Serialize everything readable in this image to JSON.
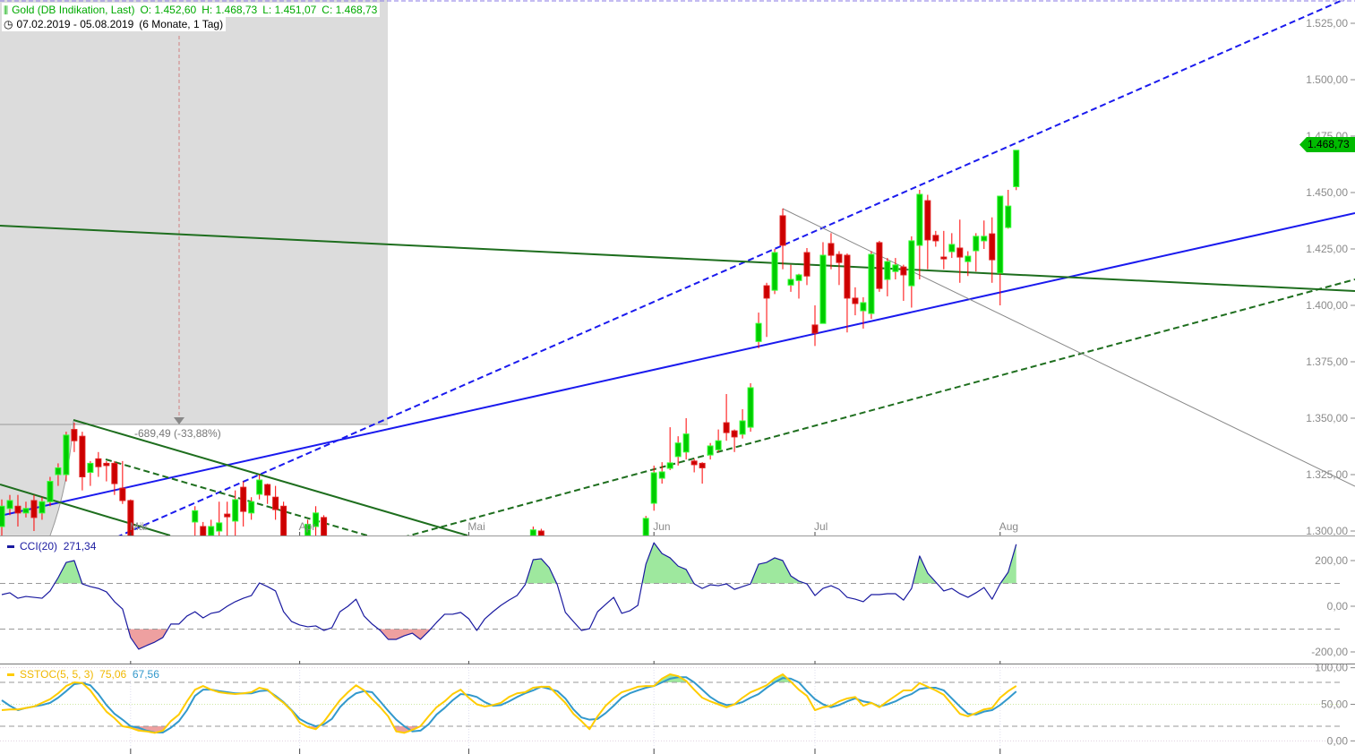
{
  "header": {
    "instrument": "Gold (DB Indikation, Last)",
    "open": "O: 1.452,60",
    "high": "H: 1.468,73",
    "low": "L: 1.451,07",
    "close": "C: 1.468,73",
    "range": "07.02.2019 - 05.08.2019",
    "period": "(6 Monate, 1 Tag)",
    "icons": [
      "chart-settings-icon",
      "clock-icon"
    ]
  },
  "measurement_label": "-689,49 (-33,88%)",
  "last_price_label": "1.468,73",
  "colors": {
    "up": "#00cc00",
    "down": "#cc0000",
    "wick": "#ff0000",
    "trend_blue": "#1a1aee",
    "trend_green": "#1e6e1e",
    "cci": "#1a1aa0",
    "stoc_k": "#ffcc00",
    "stoc_d": "#3399cc",
    "last_price_bg": "#00bb00"
  },
  "price_axis": [
    {
      "value": 1525,
      "label": "1.525,00"
    },
    {
      "value": 1500,
      "label": "1.500,00"
    },
    {
      "value": 1475,
      "label": "1.475,00"
    },
    {
      "value": 1450,
      "label": "1.450,00"
    },
    {
      "value": 1425,
      "label": "1.425,00"
    },
    {
      "value": 1400,
      "label": "1.400,00"
    },
    {
      "value": 1375,
      "label": "1.375,00"
    },
    {
      "value": 1350,
      "label": "1.350,00"
    },
    {
      "value": 1325,
      "label": "1.325,00"
    },
    {
      "value": 1300,
      "label": "1.300,00"
    }
  ],
  "months": [
    {
      "label": "Mär",
      "n": 16
    },
    {
      "label": "Apr",
      "n": 37
    },
    {
      "label": "Mai",
      "n": 58
    },
    {
      "label": "Jun",
      "n": 81
    },
    {
      "label": "Jul",
      "n": 101
    },
    {
      "label": "Aug",
      "n": 124
    }
  ],
  "cci": {
    "label": "CCI(20)",
    "value": "271,34",
    "axis": [
      {
        "value": 200,
        "label": "200,00"
      },
      {
        "value": 0,
        "label": "0,00"
      },
      {
        "value": -200,
        "label": "-200,00"
      }
    ],
    "levels": [
      100,
      -100
    ],
    "values": [
      51,
      59,
      35,
      43,
      39,
      35,
      67,
      125,
      192,
      200,
      98,
      86,
      78,
      63,
      20,
      -12,
      -137,
      -188,
      -172,
      -157,
      -137,
      -78,
      -78,
      -43,
      -24,
      -51,
      -31,
      -24,
      0,
      20,
      35,
      47,
      102,
      86,
      67,
      -24,
      -67,
      -82,
      -90,
      -86,
      -106,
      -94,
      -24,
      0,
      31,
      -43,
      -78,
      -106,
      -145,
      -145,
      -129,
      -118,
      -145,
      -110,
      -71,
      -35,
      -35,
      -27,
      -55,
      -106,
      -55,
      -24,
      4,
      27,
      47,
      94,
      204,
      208,
      169,
      94,
      -27,
      -67,
      -106,
      -98,
      -24,
      8,
      39,
      -31,
      -20,
      4,
      184,
      278,
      231,
      212,
      176,
      161,
      98,
      78,
      94,
      90,
      98,
      74,
      86,
      98,
      184,
      192,
      212,
      200,
      133,
      110,
      98,
      47,
      78,
      90,
      74,
      39,
      31,
      20,
      51,
      51,
      55,
      55,
      27,
      78,
      220,
      145,
      106,
      67,
      78,
      55,
      39,
      59,
      82,
      31,
      98,
      149,
      271.34
    ]
  },
  "sstoc": {
    "label": "SSTOC(5, 5, 3)",
    "k_value": "75,06",
    "d_value": "67,56",
    "axis": [
      {
        "value": 100,
        "label": "100,00"
      },
      {
        "value": 50,
        "label": "50,00"
      },
      {
        "value": 0,
        "label": "0,00"
      }
    ],
    "levels": [
      80,
      20
    ],
    "k": [
      42,
      43,
      43,
      45,
      47,
      52,
      57,
      65,
      75,
      80,
      79,
      69,
      54,
      40,
      31,
      20,
      18,
      14,
      13,
      11,
      14,
      27,
      36,
      54,
      70,
      75,
      70,
      66.5,
      65,
      64,
      65,
      66.5,
      72.6,
      70,
      60,
      52,
      41,
      25,
      19,
      16,
      26,
      41,
      55.5,
      66.5,
      76,
      69,
      57,
      46,
      33.5,
      13,
      11,
      15,
      20,
      33.5,
      46,
      54,
      64,
      70,
      59,
      50,
      47,
      49,
      52,
      60,
      65,
      66.5,
      72.6,
      74,
      74,
      63,
      52,
      37,
      27,
      16,
      33.5,
      48,
      58,
      66.5,
      70,
      74,
      75,
      75,
      85,
      91,
      88.5,
      82,
      70,
      59,
      54,
      50,
      46,
      50,
      59,
      66.5,
      71,
      76,
      85,
      91,
      81,
      70,
      61.6,
      42,
      46,
      48,
      54,
      58,
      60,
      48,
      52,
      46,
      54,
      61.6,
      69,
      69,
      79,
      74,
      69,
      63,
      50,
      37,
      33.5,
      38,
      43,
      45,
      59,
      68,
      75.06
    ],
    "d": [
      55.5,
      48,
      42,
      45,
      47,
      49,
      52,
      59,
      68,
      77.5,
      79,
      76,
      64,
      49,
      37,
      29,
      20,
      18,
      14,
      11.5,
      11.5,
      18,
      27,
      42,
      61.6,
      70,
      70,
      68,
      66.5,
      65,
      65,
      65,
      68,
      69,
      61.6,
      53,
      42,
      30,
      24,
      20,
      22.5,
      30,
      46,
      57,
      65,
      68,
      66.5,
      54,
      41,
      29,
      20,
      13,
      14,
      22.5,
      36,
      45,
      55.5,
      64,
      63,
      60,
      53,
      48,
      49,
      54,
      60,
      65,
      69,
      74,
      71,
      68,
      58,
      43,
      32,
      29,
      30,
      38,
      48,
      59,
      65,
      69,
      72.6,
      75,
      80,
      85,
      87,
      87,
      80,
      70,
      60,
      53,
      49,
      50,
      53,
      59,
      64,
      72.6,
      80,
      86,
      85,
      80,
      68,
      57,
      50,
      46,
      49,
      54,
      58,
      54,
      52,
      47,
      50,
      54,
      60,
      64,
      71,
      72.6,
      72.6,
      69,
      58,
      47,
      37,
      36,
      40,
      42,
      49,
      58,
      67.56
    ]
  },
  "chart_data": {
    "type": "candlestick",
    "candles": [
      {
        "n": 0,
        "o": 1302,
        "h": 1314,
        "l": 1298,
        "c": 1311
      },
      {
        "n": 1,
        "o": 1310,
        "h": 1316,
        "l": 1307,
        "c": 1313.5
      },
      {
        "n": 2,
        "o": 1311,
        "h": 1316,
        "l": 1302,
        "c": 1308
      },
      {
        "n": 3,
        "o": 1308,
        "h": 1313,
        "l": 1306,
        "c": 1310
      },
      {
        "n": 4,
        "o": 1313.5,
        "h": 1316,
        "l": 1300,
        "c": 1306
      },
      {
        "n": 5,
        "o": 1308,
        "h": 1315,
        "l": 1305,
        "c": 1313
      },
      {
        "n": 6,
        "o": 1313,
        "h": 1324,
        "l": 1311,
        "c": 1322
      },
      {
        "n": 7,
        "o": 1325,
        "h": 1330,
        "l": 1320,
        "c": 1328
      },
      {
        "n": 8,
        "o": 1325,
        "h": 1344,
        "l": 1322,
        "c": 1342.5
      },
      {
        "n": 9,
        "o": 1345,
        "h": 1348,
        "l": 1335,
        "c": 1340
      },
      {
        "n": 10,
        "o": 1342,
        "h": 1344,
        "l": 1318,
        "c": 1324
      },
      {
        "n": 11,
        "o": 1326,
        "h": 1331,
        "l": 1320,
        "c": 1330
      },
      {
        "n": 12,
        "o": 1332,
        "h": 1335,
        "l": 1324,
        "c": 1328.5
      },
      {
        "n": 13,
        "o": 1330,
        "h": 1331,
        "l": 1322,
        "c": 1329
      },
      {
        "n": 14,
        "o": 1330,
        "h": 1331,
        "l": 1316,
        "c": 1321
      },
      {
        "n": 15,
        "o": 1319,
        "h": 1331,
        "l": 1312,
        "c": 1313.5
      },
      {
        "n": 16,
        "o": 1313.5,
        "h": 1314,
        "l": 1290,
        "c": 1298
      },
      {
        "n": 24,
        "o": 1304,
        "h": 1311,
        "l": 1298,
        "c": 1309
      },
      {
        "n": 25,
        "o": 1302,
        "h": 1304,
        "l": 1294,
        "c": 1297
      },
      {
        "n": 26,
        "o": 1298,
        "h": 1305,
        "l": 1292,
        "c": 1302
      },
      {
        "n": 27,
        "o": 1300,
        "h": 1313,
        "l": 1292,
        "c": 1303.6
      },
      {
        "n": 28,
        "o": 1307.5,
        "h": 1313,
        "l": 1290,
        "c": 1306.3
      },
      {
        "n": 29,
        "o": 1304.4,
        "h": 1318,
        "l": 1295,
        "c": 1313.9
      },
      {
        "n": 30,
        "o": 1319.4,
        "h": 1322,
        "l": 1302,
        "c": 1308.7
      },
      {
        "n": 31,
        "o": 1308,
        "h": 1315,
        "l": 1305,
        "c": 1313
      },
      {
        "n": 32,
        "o": 1316.3,
        "h": 1325,
        "l": 1314,
        "c": 1322.6
      },
      {
        "n": 33,
        "o": 1320.6,
        "h": 1321,
        "l": 1312,
        "c": 1315.9
      },
      {
        "n": 34,
        "o": 1315,
        "h": 1320,
        "l": 1305,
        "c": 1309.5
      },
      {
        "n": 35,
        "o": 1311,
        "h": 1313,
        "l": 1290,
        "c": 1297
      },
      {
        "n": 38,
        "o": 1298,
        "h": 1305,
        "l": 1295,
        "c": 1303
      },
      {
        "n": 39,
        "o": 1302,
        "h": 1311,
        "l": 1298,
        "c": 1308
      },
      {
        "n": 40,
        "o": 1306,
        "h": 1307,
        "l": 1292,
        "c": 1297
      },
      {
        "n": 66,
        "o": 1298,
        "h": 1302,
        "l": 1296,
        "c": 1300.5
      },
      {
        "n": 67,
        "o": 1300,
        "h": 1301,
        "l": 1296,
        "c": 1298
      },
      {
        "n": 80,
        "o": 1298,
        "h": 1306.7,
        "l": 1297,
        "c": 1305.6
      },
      {
        "n": 81,
        "o": 1312.3,
        "h": 1329,
        "l": 1309,
        "c": 1325.8
      },
      {
        "n": 82,
        "o": 1323.4,
        "h": 1330.5,
        "l": 1321,
        "c": 1326.2
      },
      {
        "n": 83,
        "o": 1327.8,
        "h": 1346,
        "l": 1327,
        "c": 1330.2
      },
      {
        "n": 84,
        "o": 1333,
        "h": 1342,
        "l": 1329,
        "c": 1339
      },
      {
        "n": 85,
        "o": 1335,
        "h": 1350,
        "l": 1331.7,
        "c": 1343
      },
      {
        "n": 86,
        "o": 1331,
        "h": 1332,
        "l": 1326,
        "c": 1329.4
      },
      {
        "n": 87,
        "o": 1330,
        "h": 1330.5,
        "l": 1321,
        "c": 1328
      },
      {
        "n": 88,
        "o": 1333.7,
        "h": 1339,
        "l": 1331.7,
        "c": 1337.7
      },
      {
        "n": 89,
        "o": 1336,
        "h": 1345,
        "l": 1335,
        "c": 1340
      },
      {
        "n": 90,
        "o": 1348,
        "h": 1360.7,
        "l": 1340,
        "c": 1343.6
      },
      {
        "n": 91,
        "o": 1344.4,
        "h": 1345,
        "l": 1335,
        "c": 1341.7
      },
      {
        "n": 92,
        "o": 1342.9,
        "h": 1354,
        "l": 1341,
        "c": 1348.8
      },
      {
        "n": 93,
        "o": 1346,
        "h": 1365.5,
        "l": 1344,
        "c": 1363.5
      },
      {
        "n": 94,
        "o": 1384,
        "h": 1396.8,
        "l": 1381,
        "c": 1392
      },
      {
        "n": 95,
        "o": 1408.7,
        "h": 1410,
        "l": 1386,
        "c": 1403.2
      },
      {
        "n": 96,
        "o": 1406.7,
        "h": 1425,
        "l": 1405,
        "c": 1423.4
      },
      {
        "n": 97,
        "o": 1439.7,
        "h": 1442.9,
        "l": 1416,
        "c": 1426.6
      },
      {
        "n": 98,
        "o": 1409,
        "h": 1418,
        "l": 1406,
        "c": 1411.5
      },
      {
        "n": 99,
        "o": 1411,
        "h": 1414,
        "l": 1403,
        "c": 1413.5
      },
      {
        "n": 100,
        "o": 1423.4,
        "h": 1425.4,
        "l": 1409,
        "c": 1413
      },
      {
        "n": 101,
        "o": 1391.3,
        "h": 1400,
        "l": 1382,
        "c": 1387.7
      },
      {
        "n": 102,
        "o": 1392,
        "h": 1428,
        "l": 1392,
        "c": 1422.2
      },
      {
        "n": 103,
        "o": 1427.4,
        "h": 1432,
        "l": 1416,
        "c": 1422.2
      },
      {
        "n": 104,
        "o": 1422.6,
        "h": 1424,
        "l": 1409,
        "c": 1419
      },
      {
        "n": 105,
        "o": 1422.2,
        "h": 1423,
        "l": 1388,
        "c": 1403.2
      },
      {
        "n": 106,
        "o": 1403.2,
        "h": 1408,
        "l": 1395.6,
        "c": 1400.8
      },
      {
        "n": 107,
        "o": 1397.6,
        "h": 1403.6,
        "l": 1389.7,
        "c": 1401.2
      },
      {
        "n": 108,
        "o": 1396.4,
        "h": 1424,
        "l": 1394,
        "c": 1422.6
      },
      {
        "n": 109,
        "o": 1427.8,
        "h": 1428.6,
        "l": 1406,
        "c": 1407.5
      },
      {
        "n": 110,
        "o": 1411.5,
        "h": 1421,
        "l": 1404,
        "c": 1419.4
      },
      {
        "n": 111,
        "o": 1415,
        "h": 1421,
        "l": 1411.5,
        "c": 1417.9
      },
      {
        "n": 112,
        "o": 1417,
        "h": 1418,
        "l": 1402,
        "c": 1413.5
      },
      {
        "n": 113,
        "o": 1408.7,
        "h": 1430.6,
        "l": 1399,
        "c": 1428.6
      },
      {
        "n": 114,
        "o": 1426.6,
        "h": 1451.2,
        "l": 1411.5,
        "c": 1449.2
      },
      {
        "n": 115,
        "o": 1446.4,
        "h": 1449,
        "l": 1416,
        "c": 1429
      },
      {
        "n": 116,
        "o": 1431,
        "h": 1433,
        "l": 1426,
        "c": 1428.6
      },
      {
        "n": 117,
        "o": 1421.4,
        "h": 1433,
        "l": 1416,
        "c": 1420.6
      },
      {
        "n": 118,
        "o": 1423.8,
        "h": 1432,
        "l": 1421,
        "c": 1427
      },
      {
        "n": 119,
        "o": 1425.4,
        "h": 1438,
        "l": 1410,
        "c": 1421.4
      },
      {
        "n": 120,
        "o": 1419.4,
        "h": 1424,
        "l": 1413,
        "c": 1421.8
      },
      {
        "n": 121,
        "o": 1424.2,
        "h": 1432,
        "l": 1415,
        "c": 1430.6
      },
      {
        "n": 122,
        "o": 1428.6,
        "h": 1437.6,
        "l": 1425,
        "c": 1430.6
      },
      {
        "n": 123,
        "o": 1431.7,
        "h": 1439,
        "l": 1410,
        "c": 1420.2
      },
      {
        "n": 124,
        "o": 1414.3,
        "h": 1446.4,
        "l": 1400,
        "c": 1448.4
      },
      {
        "n": 125,
        "o": 1434.5,
        "h": 1451.2,
        "l": 1434,
        "c": 1444
      },
      {
        "n": 126,
        "o": 1452.6,
        "h": 1468.73,
        "l": 1451.07,
        "c": 1468.73
      }
    ],
    "ylim": [
      1300,
      1535
    ]
  }
}
